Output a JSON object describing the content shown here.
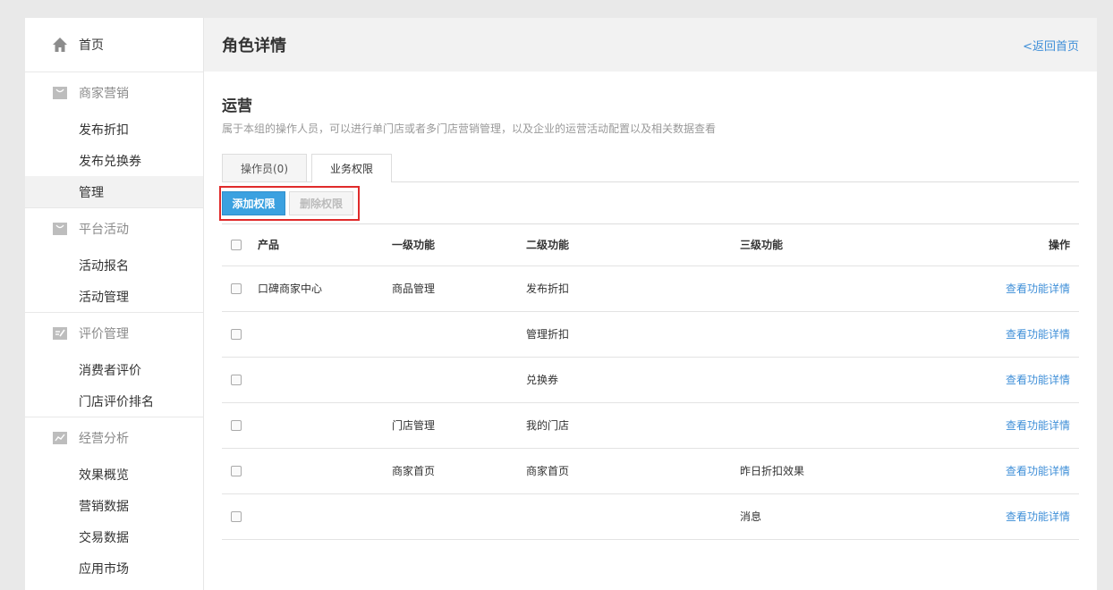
{
  "sidebar": {
    "home": {
      "label": "首页",
      "icon": "home-icon"
    },
    "groups": [
      {
        "title": "商家营销",
        "icon": "bag-icon",
        "items": [
          "发布折扣",
          "发布兑换券",
          "管理"
        ],
        "active": 2
      },
      {
        "title": "平台活动",
        "icon": "bag-icon",
        "items": [
          "活动报名",
          "活动管理"
        ]
      },
      {
        "title": "评价管理",
        "icon": "edit-icon",
        "items": [
          "消费者评价",
          "门店评价排名"
        ]
      },
      {
        "title": "经营分析",
        "icon": "chart-icon",
        "items": [
          "效果概览",
          "营销数据",
          "交易数据",
          "应用市场"
        ]
      }
    ]
  },
  "header": {
    "title": "角色详情",
    "back_link": "<返回首页"
  },
  "role": {
    "name": "运营",
    "description": "属于本组的操作人员，可以进行单门店或者多门店营销管理，以及企业的运营活动配置以及相关数据查看"
  },
  "tabs": [
    {
      "label": "操作员(0)",
      "active": false
    },
    {
      "label": "业务权限",
      "active": true
    }
  ],
  "actions": {
    "add_label": "添加权限",
    "delete_label": "删除权限"
  },
  "table": {
    "headers": {
      "product": "产品",
      "level1": "一级功能",
      "level2": "二级功能",
      "level3": "三级功能",
      "operation": "操作"
    },
    "rows": [
      {
        "product": "口碑商家中心",
        "level1": "商品管理",
        "level2": "发布折扣",
        "level3": "",
        "operation": "查看功能详情"
      },
      {
        "product": "",
        "level1": "",
        "level2": "管理折扣",
        "level3": "",
        "operation": "查看功能详情"
      },
      {
        "product": "",
        "level1": "",
        "level2": "兑换券",
        "level3": "",
        "operation": "查看功能详情"
      },
      {
        "product": "",
        "level1": "门店管理",
        "level2": "我的门店",
        "level3": "",
        "operation": "查看功能详情"
      },
      {
        "product": "",
        "level1": "商家首页",
        "level2": "商家首页",
        "level3": "昨日折扣效果",
        "operation": "查看功能详情"
      },
      {
        "product": "",
        "level1": "",
        "level2": "",
        "level3": "消息",
        "operation": "查看功能详情"
      }
    ]
  },
  "colors": {
    "accent": "#3ba1e0",
    "link": "#3f8fd8",
    "highlight": "#e02b2b"
  }
}
